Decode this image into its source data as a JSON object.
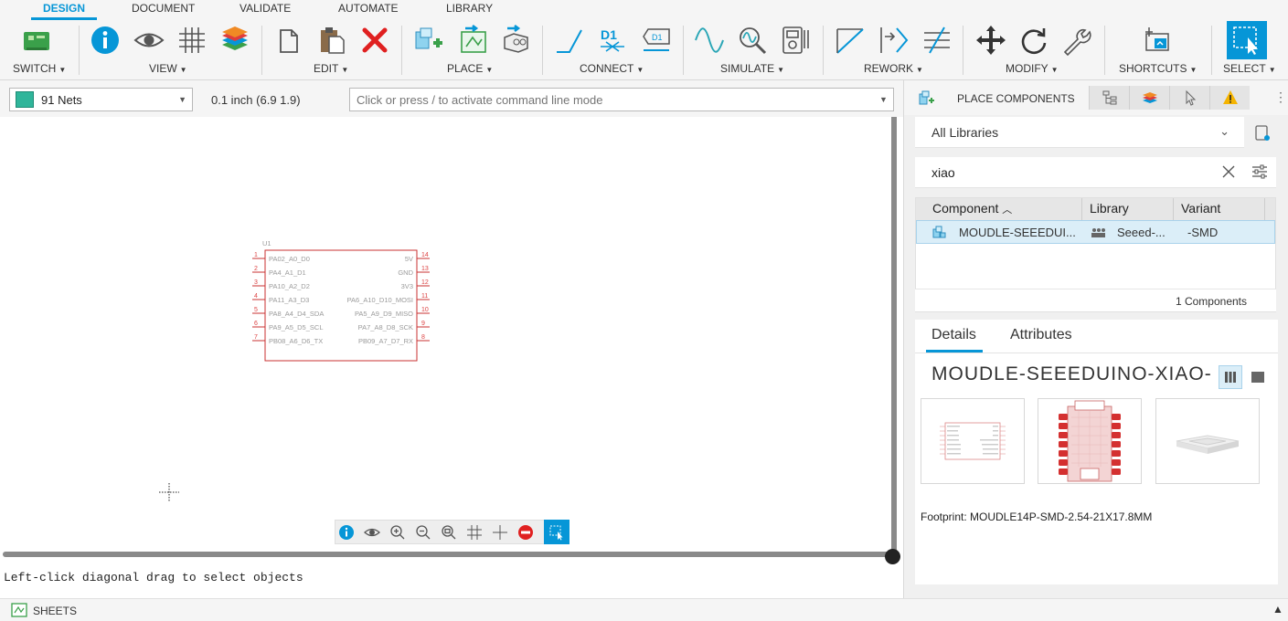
{
  "tabs": [
    {
      "label": "DESIGN",
      "active": true
    },
    {
      "label": "DOCUMENT",
      "active": false
    },
    {
      "label": "VALIDATE",
      "active": false
    },
    {
      "label": "AUTOMATE",
      "active": false
    },
    {
      "label": "LIBRARY",
      "active": false
    }
  ],
  "ribbon": {
    "groups": {
      "switch": "SWITCH",
      "view": "VIEW",
      "edit": "EDIT",
      "place": "PLACE",
      "connect": "CONNECT",
      "simulate": "SIMULATE",
      "rework": "REWORK",
      "modify": "MODIFY",
      "shortcuts": "SHORTCUTS",
      "select": "SELECT"
    },
    "d1_text": "D1"
  },
  "options": {
    "nets_value": "91 Nets",
    "grid_readout": "0.1 inch (6.9 1.9)",
    "command_placeholder": "Click or press / to activate command line mode"
  },
  "schematic": {
    "ref": "U1",
    "left_pins": [
      {
        "num": "1",
        "name": "PA02_A0_D0"
      },
      {
        "num": "2",
        "name": "PA4_A1_D1"
      },
      {
        "num": "3",
        "name": "PA10_A2_D2"
      },
      {
        "num": "4",
        "name": "PA11_A3_D3"
      },
      {
        "num": "5",
        "name": "PA8_A4_D4_SDA"
      },
      {
        "num": "6",
        "name": "PA9_A5_D5_SCL"
      },
      {
        "num": "7",
        "name": "PB08_A6_D6_TX"
      }
    ],
    "right_pins": [
      {
        "num": "14",
        "name": "5V"
      },
      {
        "num": "13",
        "name": "GND"
      },
      {
        "num": "12",
        "name": "3V3"
      },
      {
        "num": "11",
        "name": "PA6_A10_D10_MOSI"
      },
      {
        "num": "10",
        "name": "PA5_A9_D9_MISO"
      },
      {
        "num": "9",
        "name": "PA7_A8_D8_SCK"
      },
      {
        "num": "8",
        "name": "PB09_A7_D7_RX"
      }
    ]
  },
  "status": {
    "message": "Left-click diagonal drag to select objects",
    "sheets_label": "SHEETS"
  },
  "panel": {
    "title": "PLACE COMPONENTS",
    "library_select": "All Libraries",
    "search_value": "xiao",
    "columns": [
      "Component",
      "Library",
      "Variant"
    ],
    "rows": [
      {
        "component": "MOUDLE-SEEEDUI...",
        "library": "Seeed-...",
        "variant": "-SMD"
      }
    ],
    "count_text": "1 Components",
    "detail_tabs": [
      "Details",
      "Attributes"
    ],
    "component_name": "MOUDLE-SEEEDUINO-XIAO-",
    "footprint": "Footprint: MOUDLE14P-SMD-2.54-21X17.8MM"
  },
  "colors": {
    "accent": "#0696d7",
    "delete_red": "#e02020",
    "schematic_red": "#c83232",
    "selection_row": "#dbeef8"
  }
}
